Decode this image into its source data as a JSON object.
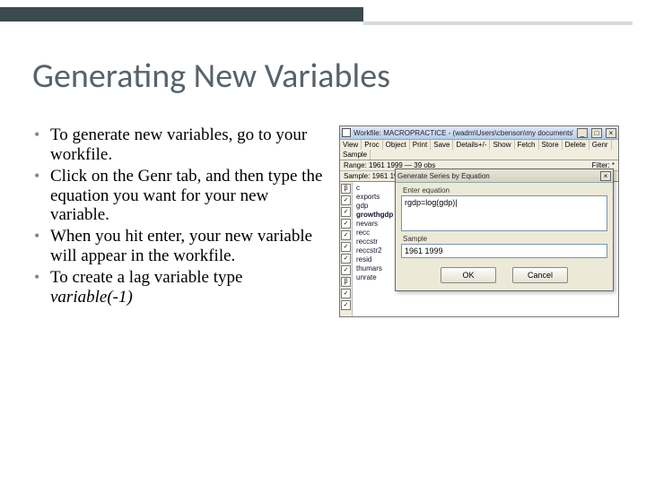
{
  "title": "Generating New Variables",
  "bullets": {
    "b1": "To generate new variables, go to your workfile.",
    "b2": "Click on the Genr tab, and then type the equation you want for your new variable.",
    "b3": "When you hit enter, your new variable will appear in the workfile.",
    "b4_pre": "To create a lag variable type ",
    "b4_em": "variable(-1)"
  },
  "workfile": {
    "title": "Workfile: MACROPRACTICE - (wadm\\Users\\cbenson\\my documents\\ma…",
    "toolbar": {
      "t1": "View",
      "t2": "Proc",
      "t3": "Object",
      "t4": "Print",
      "t5": "Save",
      "t6": "Details+/-",
      "t7": "Show",
      "t8": "Fetch",
      "t9": "Store",
      "t10": "Delete",
      "t11": "Genr",
      "t12": "Sample"
    },
    "range": "Range: 1961 1999   —   39 obs",
    "filter": "Filter: *",
    "sample": "Sample: 1961 1999",
    "vars": {
      "v1": "c",
      "v2": "exports",
      "v3": "gdp",
      "v4": "growthgdp",
      "v5": "nevars",
      "v6": "recc",
      "v7": "reccstr",
      "v8": "reccstr2",
      "v9": "resid",
      "v10": "thumars",
      "v11": "unrate"
    }
  },
  "dialog": {
    "title": "Generate Series by Equation",
    "eq_label": "Enter equation",
    "eq_value": "rgdp=log(gdp)",
    "sample_label": "Sample",
    "sample_value": "1961 1999",
    "ok": "OK",
    "cancel": "Cancel"
  },
  "ctl": {
    "min": "_",
    "max": "□",
    "close": "×"
  }
}
